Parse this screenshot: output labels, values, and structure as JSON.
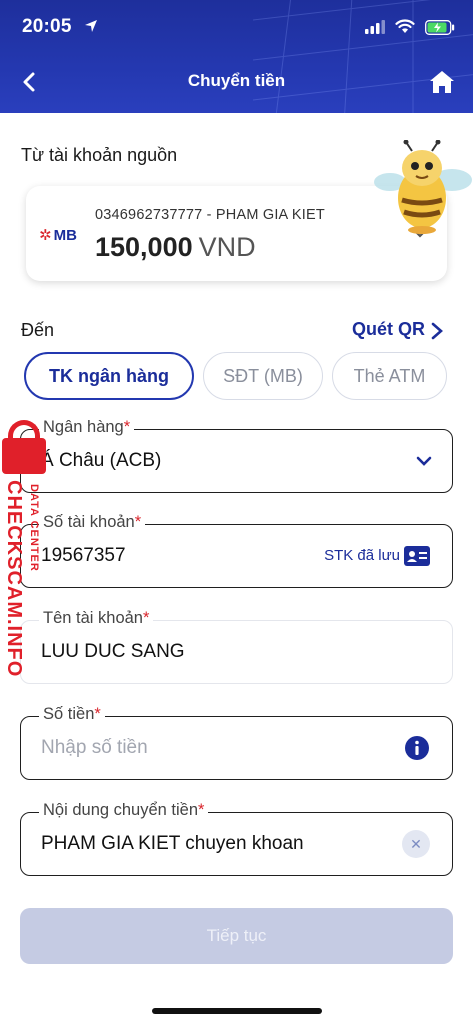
{
  "status_bar": {
    "time": "20:05"
  },
  "header": {
    "title": "Chuyển tiền"
  },
  "source": {
    "label": "Từ tài khoản nguồn",
    "bank_logo": "MB",
    "account_line": "0346962737777 - PHAM GIA KIET",
    "balance": "150,000",
    "currency": "VND"
  },
  "destination": {
    "label": "Đến",
    "scan_qr": "Quét QR",
    "tabs": [
      {
        "label": "TK ngân hàng",
        "active": true
      },
      {
        "label": "SĐT (MB)",
        "active": false
      },
      {
        "label": "Thẻ ATM",
        "active": false
      }
    ]
  },
  "form": {
    "bank": {
      "label": "Ngân hàng",
      "required": "*",
      "value": "Á Châu (ACB)"
    },
    "account_number": {
      "label": "Số tài khoản",
      "required": "*",
      "value": "19567357",
      "saved_label": "STK đã lưu"
    },
    "account_name": {
      "label": "Tên tài khoản",
      "required": "*",
      "value": "LUU DUC SANG"
    },
    "amount": {
      "label": "Số tiền",
      "required": "*",
      "placeholder": "Nhập số tiền"
    },
    "content": {
      "label": "Nội dung chuyển tiền",
      "required": "*",
      "value": "PHAM GIA KIET chuyen khoan"
    }
  },
  "continue_button": "Tiếp tục",
  "watermark": {
    "main": "CHECKSCAM.INFO",
    "sub": "DATA CENTER"
  },
  "colors": {
    "primary": "#1b2d9a",
    "header": "#2438b0",
    "required": "#d9252c",
    "disabled_button": "#c5cbe3"
  }
}
